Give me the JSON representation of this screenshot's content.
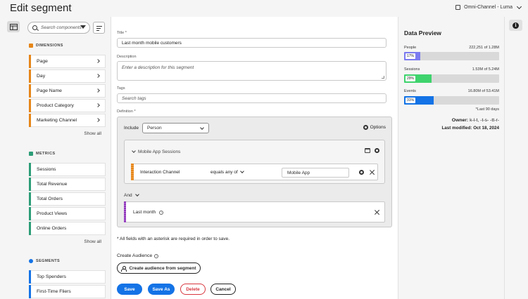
{
  "header": {
    "title": "Edit segment",
    "org_name": "Omni-Channel - Luma"
  },
  "left_panel": {
    "search_placeholder": "Search components",
    "dimensions": {
      "heading": "DIMENSIONS",
      "items": [
        "Page",
        "Day",
        "Page Name",
        "Product Category",
        "Marketing Channel"
      ],
      "show_all": "Show all"
    },
    "metrics": {
      "heading": "METRICS",
      "items": [
        "Sessions",
        "Total Revenue",
        "Total Orders",
        "Product Views",
        "Online Orders"
      ],
      "show_all": "Show all"
    },
    "segments": {
      "heading": "SEGMENTS",
      "items": [
        "Top Spenders",
        "First-Time Fliers"
      ]
    }
  },
  "form": {
    "title_label": "Title",
    "title_value": "Last month mobile customers",
    "description_label": "Description",
    "description_placeholder": "Enter a description for this segment",
    "tags_label": "Tags",
    "tags_placeholder": "Search tags",
    "definition_label": "Definition",
    "include_label": "Include",
    "include_value": "Person",
    "options_label": "Options",
    "container_title": "Mobile App Sessions",
    "rule": {
      "field": "Interaction Channel",
      "operator": "equals any of",
      "value": "Mobile App"
    },
    "and_label": "And",
    "segment_rule": "Last month",
    "required_note": "All fields with an asterisk are required in order to save.",
    "create_audience_label": "Create Audience",
    "create_audience_button": "Create audience from segment"
  },
  "actions": {
    "save": "Save",
    "save_as": "Save As",
    "delete": "Delete",
    "cancel": "Cancel"
  },
  "data_preview": {
    "title": "Data Preview",
    "metrics": [
      {
        "label": "People",
        "value": "222,251 of 1.28M",
        "percent_label": "17%",
        "fraction": 0.17,
        "color": "#7b7bf0"
      },
      {
        "label": "Sessions",
        "value": "1.53M of 5.24M",
        "percent_label": "29%",
        "fraction": 0.29,
        "color": "#3fd36d"
      },
      {
        "label": "Events",
        "value": "16.80M of 53.41M",
        "percent_label": "31%",
        "fraction": 0.31,
        "color": "#1473e6"
      }
    ],
    "note": "*Last 90 days",
    "owner_label": "Owner:",
    "owner_name": "k-l-t, -t-s- -tt-r-",
    "modified_label": "Last modified:",
    "modified_value": "Oct 18, 2024"
  },
  "colors": {
    "dimension": "#e68619",
    "metric": "#2d9d78",
    "segment": "#1473e6",
    "primary": "#1473e6",
    "negative": "#d7373f"
  }
}
